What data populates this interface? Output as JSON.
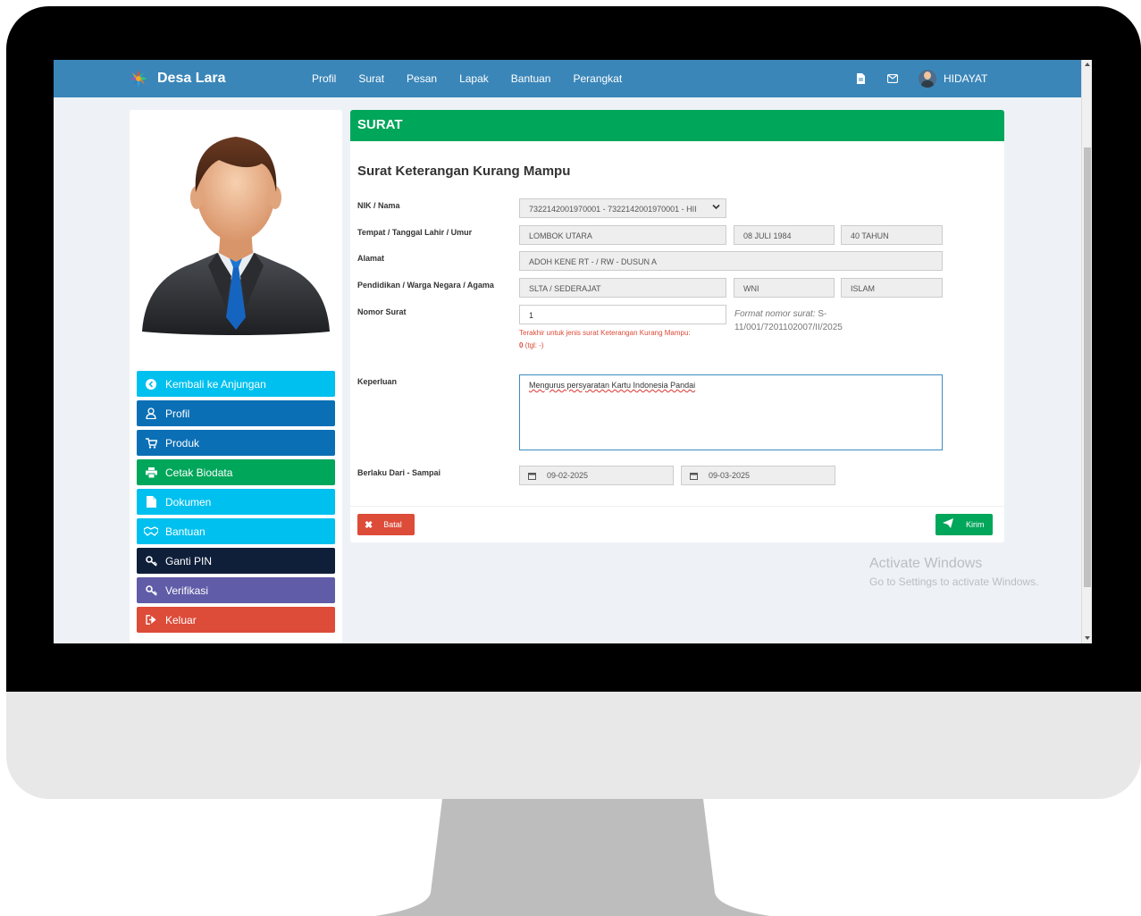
{
  "brand": {
    "name": "Desa Lara"
  },
  "nav": {
    "items": [
      "Profil",
      "Surat",
      "Pesan",
      "Lapak",
      "Bantuan",
      "Perangkat"
    ],
    "user": "HIDAYAT"
  },
  "sidebar": {
    "menu": [
      {
        "label": "Kembali ke Anjungan",
        "icon": "arrow-left-circle-icon",
        "color": "#00c0ef"
      },
      {
        "label": "Profil",
        "icon": "user-icon",
        "color": "#0b6fb5"
      },
      {
        "label": "Produk",
        "icon": "cart-icon",
        "color": "#0b6fb5"
      },
      {
        "label": "Cetak Biodata",
        "icon": "print-icon",
        "color": "#00a65a"
      },
      {
        "label": "Dokumen",
        "icon": "file-icon",
        "color": "#00c0ef"
      },
      {
        "label": "Bantuan",
        "icon": "handshake-icon",
        "color": "#00c0ef"
      },
      {
        "label": "Ganti PIN",
        "icon": "key-icon",
        "color": "#0f1f3a"
      },
      {
        "label": "Verifikasi",
        "icon": "key-icon",
        "color": "#605ca8"
      },
      {
        "label": "Keluar",
        "icon": "sign-out-icon",
        "color": "#dd4b39"
      }
    ]
  },
  "panel": {
    "header": "SURAT",
    "title": "Surat Keterangan Kurang Mampu",
    "labels": {
      "nik": "NIK / Nama",
      "ttl": "Tempat / Tanggal Lahir / Umur",
      "alamat": "Alamat",
      "pendidikan": "Pendidikan / Warga Negara / Agama",
      "nomor": "Nomor Surat",
      "keperluan": "Keperluan",
      "berlaku": "Berlaku Dari - Sampai"
    },
    "values": {
      "nik": "7322142001970001 - 7322142001970001 - HII",
      "tempat": "LOMBOK UTARA",
      "tanggal": "08 JULI 1984",
      "umur": "40 TAHUN",
      "alamat": "ADOH KENE RT - / RW - DUSUN A",
      "pendidikan": "SLTA / SEDERAJAT",
      "warga": "WNI",
      "agama": "ISLAM",
      "nomor": "1",
      "keperluan": "Mengurus persyaratan Kartu Indonesia Pandai",
      "dari": "09-02-2025",
      "sampai": "09-03-2025"
    },
    "hints": {
      "terakhir": "Terakhir untuk jenis surat Keterangan Kurang Mampu:",
      "terakhir_value": "0",
      "terakhir_tgl": "(tgl: -)",
      "format_label": "Format nomor surat:",
      "format_value": "S-11/001/7201102007/II/2025"
    },
    "buttons": {
      "batal": "Batal",
      "kirim": "Kirim"
    }
  },
  "watermark": {
    "line1": "Activate Windows",
    "line2": "Go to Settings to activate Windows."
  }
}
